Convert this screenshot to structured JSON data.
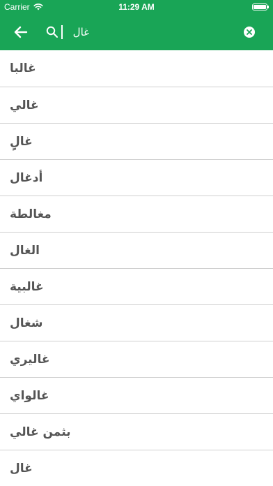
{
  "status_bar": {
    "carrier": "Carrier",
    "time": "11:29 AM"
  },
  "toolbar": {
    "background_color": "#19a556",
    "search_value": "غال",
    "back_icon": "arrow-left-icon",
    "search_icon": "magnifier-icon",
    "clear_icon": "clear-circle-icon"
  },
  "results": [
    "غالبا",
    "غالي",
    "غالٍ",
    "أدغال",
    "مغالطة",
    "الغال",
    "غالبية",
    "شغال",
    "غاليري",
    "غالواي",
    "بثمن غالي",
    "غال"
  ]
}
